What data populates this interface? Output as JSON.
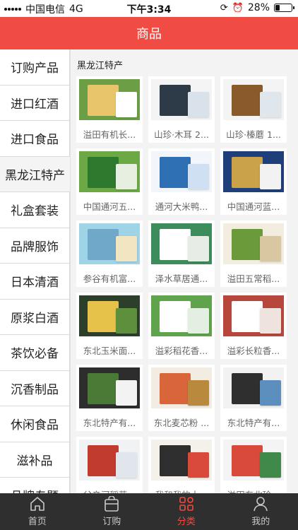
{
  "status_bar": {
    "carrier": "中国电信",
    "network": "4G",
    "time": "下午3:34",
    "battery": "28%",
    "battery_level": 0.28
  },
  "header": {
    "title": "商品"
  },
  "sidebar": {
    "items": [
      {
        "label": "订购产品"
      },
      {
        "label": "进口红酒"
      },
      {
        "label": "进口食品"
      },
      {
        "label": "黑龙江特产"
      },
      {
        "label": "礼盒套装"
      },
      {
        "label": "品牌服饰"
      },
      {
        "label": "日本清酒"
      },
      {
        "label": "原浆白酒"
      },
      {
        "label": "茶饮必备"
      },
      {
        "label": "沉香制品"
      },
      {
        "label": "休闲食品"
      },
      {
        "label": "滋补品"
      },
      {
        "label": "品牌专题"
      }
    ]
  },
  "section": {
    "title": "黑龙江特产"
  },
  "products": [
    {
      "name": "溢田有机长...",
      "colors": [
        "#6b9e45",
        "#e8c56a",
        "#ffffff"
      ]
    },
    {
      "name": "山珍·木耳 2...",
      "colors": [
        "#f4f4f4",
        "#2d3b48",
        "#d9e2ea"
      ]
    },
    {
      "name": "山珍·榛蘑 1...",
      "colors": [
        "#f4f4f4",
        "#8a5a2b",
        "#dfe6ec"
      ]
    },
    {
      "name": "中国通河五...",
      "colors": [
        "#6ca843",
        "#2d7a2f",
        "#e6efe0"
      ]
    },
    {
      "name": "通河大米鸭...",
      "colors": [
        "#f2f6fb",
        "#2f6fb4",
        "#cfe0f2"
      ]
    },
    {
      "name": "中国通河蓝...",
      "colors": [
        "#1f3f7a",
        "#c9a24a",
        "#f2f2f2"
      ]
    },
    {
      "name": "参谷有机富...",
      "colors": [
        "#9fd3e6",
        "#6fa8c8",
        "#f2e6c2"
      ]
    },
    {
      "name": "泽水草居通...",
      "colors": [
        "#3d8c5c",
        "#ffffff",
        "#e8ece6"
      ]
    },
    {
      "name": "溢田五常稻...",
      "colors": [
        "#f3ede0",
        "#6a9a3a",
        "#d8c7a0"
      ]
    },
    {
      "name": "东北玉米面...",
      "colors": [
        "#2b3f2a",
        "#e6c24a",
        "#5e8f3c"
      ]
    },
    {
      "name": "溢彩稻花香...",
      "colors": [
        "#5fa34d",
        "#ffffff",
        "#e3efe0"
      ]
    },
    {
      "name": "溢彩长粒香...",
      "colors": [
        "#b7473d",
        "#ffffff",
        "#efe3e0"
      ]
    },
    {
      "name": "东北特产有...",
      "colors": [
        "#2d2d2d",
        "#4a7a35",
        "#f3f3f3"
      ]
    },
    {
      "name": "东北麦芯粉 ...",
      "colors": [
        "#f2ece2",
        "#d9653b",
        "#b9893e"
      ]
    },
    {
      "name": "东北特产有...",
      "colors": [
        "#f2f2f2",
        "#2f2f2f",
        "#5c8fbe"
      ]
    },
    {
      "name": "父辛河稻花...",
      "colors": [
        "#f0f2f4",
        "#c23b2f",
        "#e0e6ec"
      ]
    },
    {
      "name": "我和我的大...",
      "colors": [
        "#f4f1ea",
        "#2f2f2f",
        "#d94a3a"
      ]
    },
    {
      "name": "溢田东北珍...",
      "colors": [
        "#f4f4f4",
        "#d94a3a",
        "#3f8a4a"
      ]
    }
  ],
  "tabbar": {
    "items": [
      {
        "label": "首页",
        "icon": "home-icon"
      },
      {
        "label": "订购",
        "icon": "bag-icon"
      },
      {
        "label": "分类",
        "icon": "category-icon"
      },
      {
        "label": "我的",
        "icon": "user-icon"
      }
    ]
  },
  "colors": {
    "brand": "#f04c43",
    "tabbar_bg": "#2f2f2f",
    "content_bg": "#f3f3f3"
  }
}
